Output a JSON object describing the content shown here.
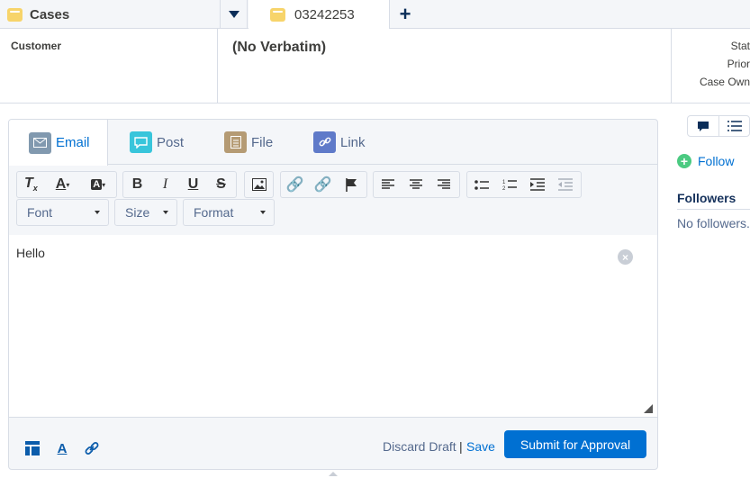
{
  "tabs": {
    "cases_label": "Cases",
    "case_label": "03242253",
    "add_label": "+"
  },
  "header": {
    "customer_label": "Customer",
    "verbatim": "(No Verbatim)",
    "status_label": "Stat",
    "priority_label": "Prior",
    "owner_label": "Case Own"
  },
  "publisher": {
    "tabs": [
      {
        "label": "Email",
        "icon": "email-icon",
        "color": "#8199af"
      },
      {
        "label": "Post",
        "icon": "post-icon",
        "color": "#38c5db"
      },
      {
        "label": "File",
        "icon": "file-icon",
        "color": "#b59b74"
      },
      {
        "label": "Link",
        "icon": "link-icon",
        "color": "#5f7ac9"
      }
    ],
    "selects": {
      "font": "Font",
      "size": "Size",
      "format": "Format"
    },
    "body_text": "Hello",
    "discard": "Discard Draft",
    "separator": "|",
    "save": "Save",
    "submit": "Submit for Approval"
  },
  "sidebar": {
    "follow": "Follow",
    "followers_heading": "Followers",
    "no_followers": "No followers."
  },
  "colors": {
    "accent": "#0070d2",
    "border": "#d8dde6",
    "bg": "#f4f6f9"
  }
}
